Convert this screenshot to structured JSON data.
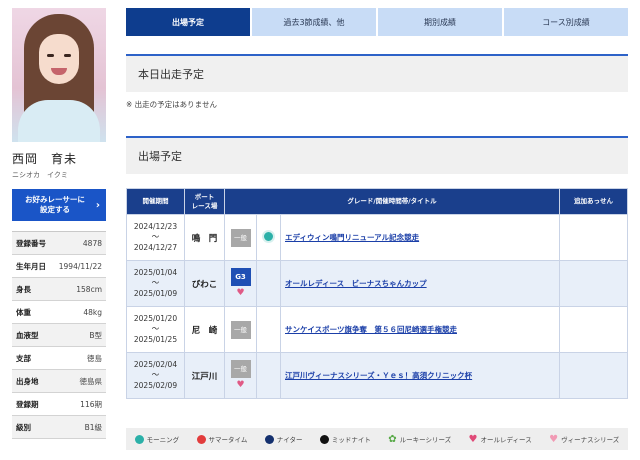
{
  "profile": {
    "name": "西岡　育未",
    "kana": "ニシオカ　イクミ",
    "fav_button": "お好みレーサーに\n設定する",
    "fav_chevron": "›",
    "info": [
      {
        "key": "登録番号",
        "value": "4878"
      },
      {
        "key": "生年月日",
        "value": "1994/11/22"
      },
      {
        "key": "身長",
        "value": "158cm"
      },
      {
        "key": "体重",
        "value": "48kg"
      },
      {
        "key": "血液型",
        "value": "B型"
      },
      {
        "key": "支部",
        "value": "徳島"
      },
      {
        "key": "出身地",
        "value": "徳島県"
      },
      {
        "key": "登録期",
        "value": "116期"
      },
      {
        "key": "級別",
        "value": "B1級"
      }
    ]
  },
  "tabs": [
    "出場予定",
    "過去3節成績、他",
    "期別成績",
    "コース別成績"
  ],
  "today_section": {
    "title": "本日出走予定",
    "note": "※ 出走の予定はありません"
  },
  "schedule_section": {
    "title": "出場予定",
    "columns": [
      "開催期間",
      "ボート\nレース場",
      "グレード/開催時間帯/タイトル",
      "追加あっせん"
    ],
    "rows": [
      {
        "start": "2024/12/23",
        "tilde": "～",
        "end": "2024/12/27",
        "venue": "鳴　門",
        "grade": "一般",
        "time_icon": "morning",
        "ladies": false,
        "title": "エディウィン鳴門リニューアル記念競走",
        "extra": ""
      },
      {
        "start": "2025/01/04",
        "tilde": "～",
        "end": "2025/01/09",
        "venue": "びわこ",
        "grade": "G3",
        "time_icon": "",
        "ladies": true,
        "title": "オールレディース　ビーナスちゃんカップ",
        "extra": ""
      },
      {
        "start": "2025/01/20",
        "tilde": "～",
        "end": "2025/01/25",
        "venue": "尼　崎",
        "grade": "一般",
        "time_icon": "",
        "ladies": false,
        "title": "サンケイスポーツ旗争奪　第５６回尼崎選手権競走",
        "extra": ""
      },
      {
        "start": "2025/02/04",
        "tilde": "～",
        "end": "2025/02/09",
        "venue": "江戸川",
        "grade": "一般",
        "time_icon": "",
        "ladies": true,
        "title": "江戸川ヴィーナスシリーズ・Ｙｅｓ！高須クリニック杯",
        "extra": ""
      }
    ]
  },
  "legend": [
    {
      "label": "モーニング",
      "icon": "morning-icon"
    },
    {
      "label": "サマータイム",
      "icon": "summer-icon"
    },
    {
      "label": "ナイター",
      "icon": "nighter-icon"
    },
    {
      "label": "ミッドナイト",
      "icon": "midnight-icon"
    },
    {
      "label": "ルーキーシリーズ",
      "icon": "rookie-icon"
    },
    {
      "label": "オールレディース",
      "icon": "ladies-icon"
    },
    {
      "label": "ヴィーナスシリーズ",
      "icon": "venus-icon"
    }
  ],
  "colors": {
    "accent": "#1a55c7",
    "header_dark": "#1a3f8c",
    "tab_active": "#0e3d8e",
    "tab_inactive": "#c8dcf6"
  }
}
